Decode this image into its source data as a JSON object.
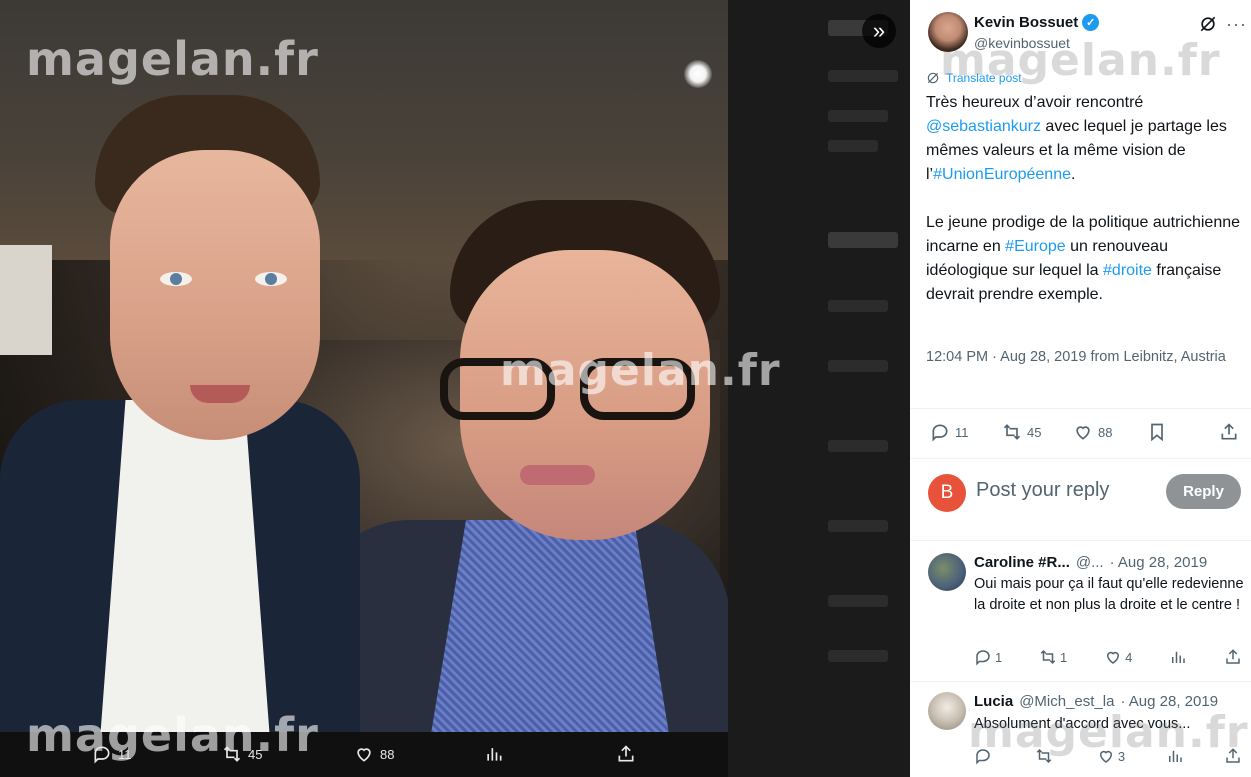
{
  "watermark": "magelan.fr",
  "media": {
    "actions": {
      "replies": "11",
      "retweets": "45",
      "likes": "88"
    }
  },
  "tweet": {
    "author": {
      "name": "Kevin Bossuet",
      "handle": "@kevinbossuet",
      "verified": true
    },
    "translate_label": "Translate post",
    "text": {
      "p1_before": "Très heureux d’avoir rencontré ",
      "mention": "@sebastiankurz",
      "p1_middle": " avec lequel je partage les mêmes valeurs et la même vision de l’",
      "hashtag_ue": "#UnionEuropéenne",
      "p1_end": ".",
      "p2_before": "Le jeune prodige de la politique autrichienne incarne en ",
      "hashtag_europe": "#Europe",
      "p2_middle": " un renouveau idéologique sur lequel la ",
      "hashtag_droite": "#droite",
      "p2_end": " française devrait prendre exemple."
    },
    "meta": "12:04 PM · Aug 28, 2019 from Leibnitz, Austria",
    "stats": {
      "replies": "11",
      "retweets": "45",
      "likes": "88"
    }
  },
  "reply_box": {
    "avatar_letter": "B",
    "placeholder": "Post your reply",
    "button": "Reply"
  },
  "comments": [
    {
      "name": "Caroline #R...",
      "handle": "@...",
      "date": "· Aug 28, 2019",
      "text": "Oui mais pour ça il faut qu'elle redevienne la droite et non plus la droite et le centre !",
      "replies": "1",
      "retweets": "1",
      "likes": "4"
    },
    {
      "name": "Lucia",
      "handle": "@Mich_est_la",
      "date": "· Aug 28, 2019",
      "text": "Absolument d'accord avec vous...",
      "replies": "",
      "retweets": "",
      "likes": "3"
    }
  ],
  "colors": {
    "accent": "#1d9bf0",
    "text": "#0f1419",
    "muted": "#536471",
    "reply_button": "#8f9396",
    "reply_avatar": "#e8523a"
  }
}
